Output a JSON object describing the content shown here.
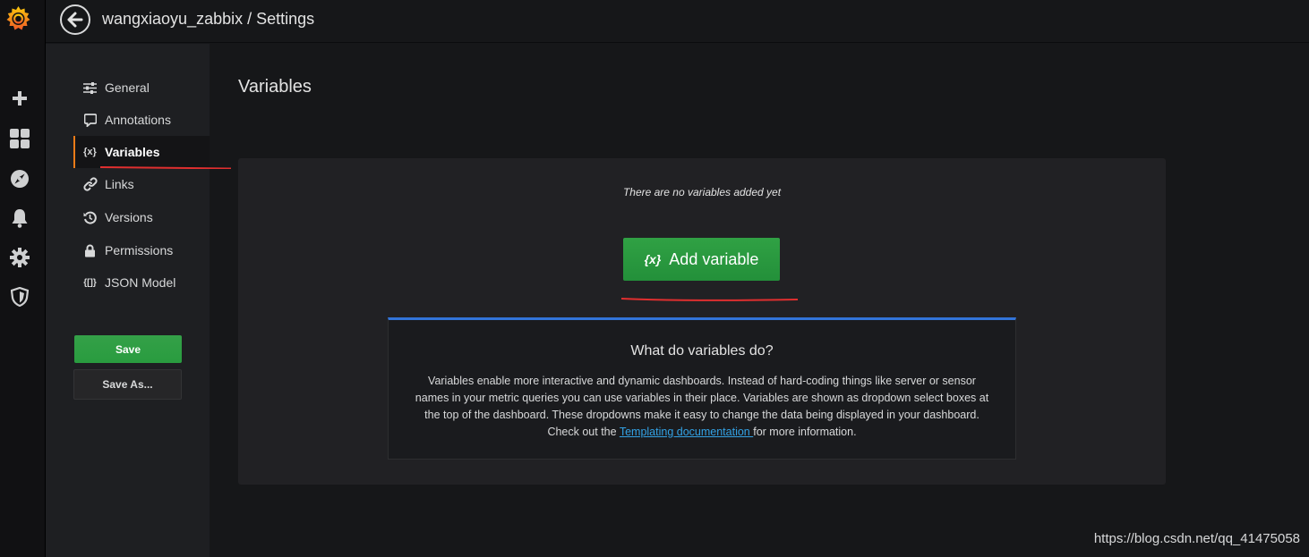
{
  "colors": {
    "accent_orange": "#eb7b18",
    "primary_green": "#299c3f",
    "info_blue": "#3274d9",
    "link_blue": "#33a2e5",
    "annotation_red": "#e02f2f"
  },
  "rail": {
    "icons": [
      "grafana-logo-icon",
      "plus-icon",
      "dashboards-icon",
      "explore-icon",
      "alerting-icon",
      "configuration-icon",
      "shield-icon"
    ]
  },
  "topbar": {
    "breadcrumb": "wangxiaoyu_zabbix / Settings"
  },
  "sidebar": {
    "items": [
      {
        "label": "General",
        "icon": "sliders-icon"
      },
      {
        "label": "Annotations",
        "icon": "comment-icon"
      },
      {
        "label": "Variables",
        "icon": "variable-icon",
        "glyph": "{x}"
      },
      {
        "label": "Links",
        "icon": "link-icon"
      },
      {
        "label": "Versions",
        "icon": "history-icon"
      },
      {
        "label": "Permissions",
        "icon": "lock-icon"
      },
      {
        "label": "JSON Model",
        "icon": "json-icon",
        "glyph": "{[]}"
      }
    ],
    "save_label": "Save",
    "save_as_label": "Save As..."
  },
  "main": {
    "title": "Variables",
    "empty_text": "There are no variables added yet",
    "add_button_glyph": "{x}",
    "add_button_label": "Add variable",
    "info_title": "What do variables do?",
    "info_body_before": "Variables enable more interactive and dynamic dashboards. Instead of hard-coding things like server or sensor names in your metric queries you can use variables in their place. Variables are shown as dropdown select boxes at the top of the dashboard. These dropdowns make it easy to change the data being displayed in your dashboard. Check out the ",
    "info_link": "Templating documentation ",
    "info_body_after": "for more information."
  },
  "watermark": "https://blog.csdn.net/qq_41475058"
}
